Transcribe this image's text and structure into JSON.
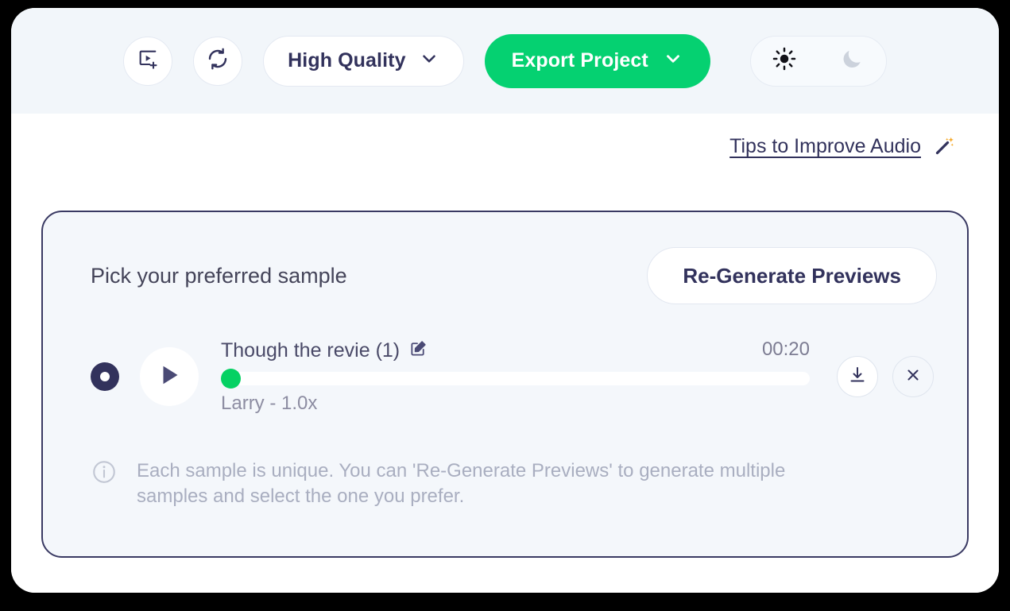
{
  "toolbar": {
    "add_media_icon": "add-video-icon",
    "refresh_icon": "refresh-icon",
    "quality_label": "High Quality",
    "quality_chevron_icon": "chevron-down-icon",
    "export_label": "Export Project",
    "export_chevron_icon": "chevron-down-icon",
    "export_color": "#05d171",
    "theme": {
      "light_icon": "sun-icon",
      "dark_icon": "moon-icon",
      "active": "light"
    }
  },
  "tips": {
    "link_label": "Tips to Improve Audio",
    "wand_icon": "magic-wand-icon"
  },
  "card": {
    "heading": "Pick your preferred sample",
    "regenerate_label": "Re-Generate Previews",
    "sample": {
      "selected": true,
      "play_icon": "play-icon",
      "name": "Though the revie (1)",
      "edit_icon": "edit-icon",
      "duration": "00:20",
      "voice": "Larry - 1.0x",
      "progress_percent": 0,
      "progress_color": "#05d163",
      "download_icon": "download-icon",
      "close_icon": "close-icon"
    },
    "info": {
      "icon": "info-icon",
      "text": "Each sample is unique. You can 'Re-Generate Previews' to generate multiple samples and select the one you prefer."
    }
  }
}
